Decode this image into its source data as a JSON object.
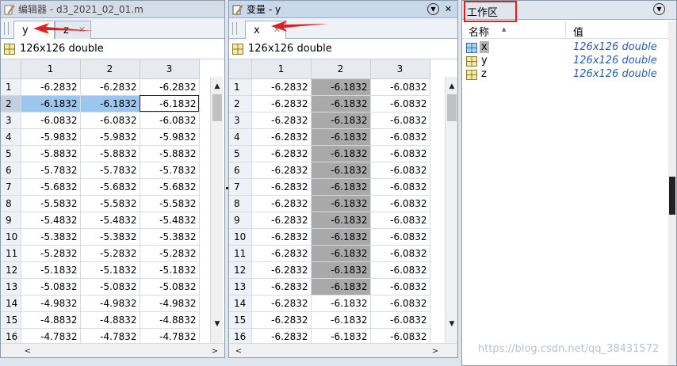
{
  "left": {
    "title": "编辑器 - d3_2021_02_01.m",
    "tabs": [
      {
        "label": "y",
        "close": "✕"
      },
      {
        "label": "z",
        "close": "✕"
      }
    ],
    "info": "126x126 double",
    "columns": [
      "1",
      "2",
      "3"
    ],
    "rows": [
      {
        "r": "1",
        "c": [
          "-6.2832",
          "-6.2832",
          "-6.2832"
        ]
      },
      {
        "r": "2",
        "c": [
          "-6.1832",
          "-6.1832",
          "-6.1832"
        ]
      },
      {
        "r": "3",
        "c": [
          "-6.0832",
          "-6.0832",
          "-6.0832"
        ]
      },
      {
        "r": "4",
        "c": [
          "-5.9832",
          "-5.9832",
          "-5.9832"
        ]
      },
      {
        "r": "5",
        "c": [
          "-5.8832",
          "-5.8832",
          "-5.8832"
        ]
      },
      {
        "r": "6",
        "c": [
          "-5.7832",
          "-5.7832",
          "-5.7832"
        ]
      },
      {
        "r": "7",
        "c": [
          "-5.6832",
          "-5.6832",
          "-5.6832"
        ]
      },
      {
        "r": "8",
        "c": [
          "-5.5832",
          "-5.5832",
          "-5.5832"
        ]
      },
      {
        "r": "9",
        "c": [
          "-5.4832",
          "-5.4832",
          "-5.4832"
        ]
      },
      {
        "r": "10",
        "c": [
          "-5.3832",
          "-5.3832",
          "-5.3832"
        ]
      },
      {
        "r": "11",
        "c": [
          "-5.2832",
          "-5.2832",
          "-5.2832"
        ]
      },
      {
        "r": "12",
        "c": [
          "-5.1832",
          "-5.1832",
          "-5.1832"
        ]
      },
      {
        "r": "13",
        "c": [
          "-5.0832",
          "-5.0832",
          "-5.0832"
        ]
      },
      {
        "r": "14",
        "c": [
          "-4.9832",
          "-4.9832",
          "-4.9832"
        ]
      },
      {
        "r": "15",
        "c": [
          "-4.8832",
          "-4.8832",
          "-4.8832"
        ]
      },
      {
        "r": "16",
        "c": [
          "-4.7832",
          "-4.7832",
          "-4.7832"
        ]
      }
    ]
  },
  "mid": {
    "title": "变量 - y",
    "tabs": [
      {
        "label": "x",
        "close": "✕"
      }
    ],
    "info": "126x126 double",
    "columns": [
      "1",
      "2",
      "3"
    ],
    "rows": [
      {
        "r": "1",
        "c": [
          "-6.2832",
          "-6.1832",
          "-6.0832"
        ]
      },
      {
        "r": "2",
        "c": [
          "-6.2832",
          "-6.1832",
          "-6.0832"
        ]
      },
      {
        "r": "3",
        "c": [
          "-6.2832",
          "-6.1832",
          "-6.0832"
        ]
      },
      {
        "r": "4",
        "c": [
          "-6.2832",
          "-6.1832",
          "-6.0832"
        ]
      },
      {
        "r": "5",
        "c": [
          "-6.2832",
          "-6.1832",
          "-6.0832"
        ]
      },
      {
        "r": "6",
        "c": [
          "-6.2832",
          "-6.1832",
          "-6.0832"
        ]
      },
      {
        "r": "7",
        "c": [
          "-6.2832",
          "-6.1832",
          "-6.0832"
        ]
      },
      {
        "r": "8",
        "c": [
          "-6.2832",
          "-6.1832",
          "-6.0832"
        ]
      },
      {
        "r": "9",
        "c": [
          "-6.2832",
          "-6.1832",
          "-6.0832"
        ]
      },
      {
        "r": "10",
        "c": [
          "-6.2832",
          "-6.1832",
          "-6.0832"
        ]
      },
      {
        "r": "11",
        "c": [
          "-6.2832",
          "-6.1832",
          "-6.0832"
        ]
      },
      {
        "r": "12",
        "c": [
          "-6.2832",
          "-6.1832",
          "-6.0832"
        ]
      },
      {
        "r": "13",
        "c": [
          "-6.2832",
          "-6.1832",
          "-6.0832"
        ]
      },
      {
        "r": "14",
        "c": [
          "-6.2832",
          "-6.1832",
          "-6.0832"
        ]
      },
      {
        "r": "15",
        "c": [
          "-6.2832",
          "-6.1832",
          "-6.0832"
        ]
      },
      {
        "r": "16",
        "c": [
          "-6.2832",
          "-6.1832",
          "-6.0832"
        ]
      }
    ]
  },
  "workspace": {
    "title": "工作区",
    "header_name": "名称",
    "header_value": "值",
    "sort_indicator": "▲",
    "vars": [
      {
        "name": "x",
        "value": "126x126 double"
      },
      {
        "name": "y",
        "value": "126x126 double"
      },
      {
        "name": "z",
        "value": "126x126 double"
      }
    ],
    "watermark": "https://blog.csdn.net/qq_38431572"
  },
  "colors": {
    "selection_blue": "#9cc6ee",
    "selected_gray": "#a9a9a9",
    "annotation_red": "#e02020",
    "value_blue": "#2a5db0"
  },
  "icons": {
    "editor": "pencil-icon",
    "variables": "variable-editor-icon",
    "matrix": "matrix-grid-icon"
  }
}
